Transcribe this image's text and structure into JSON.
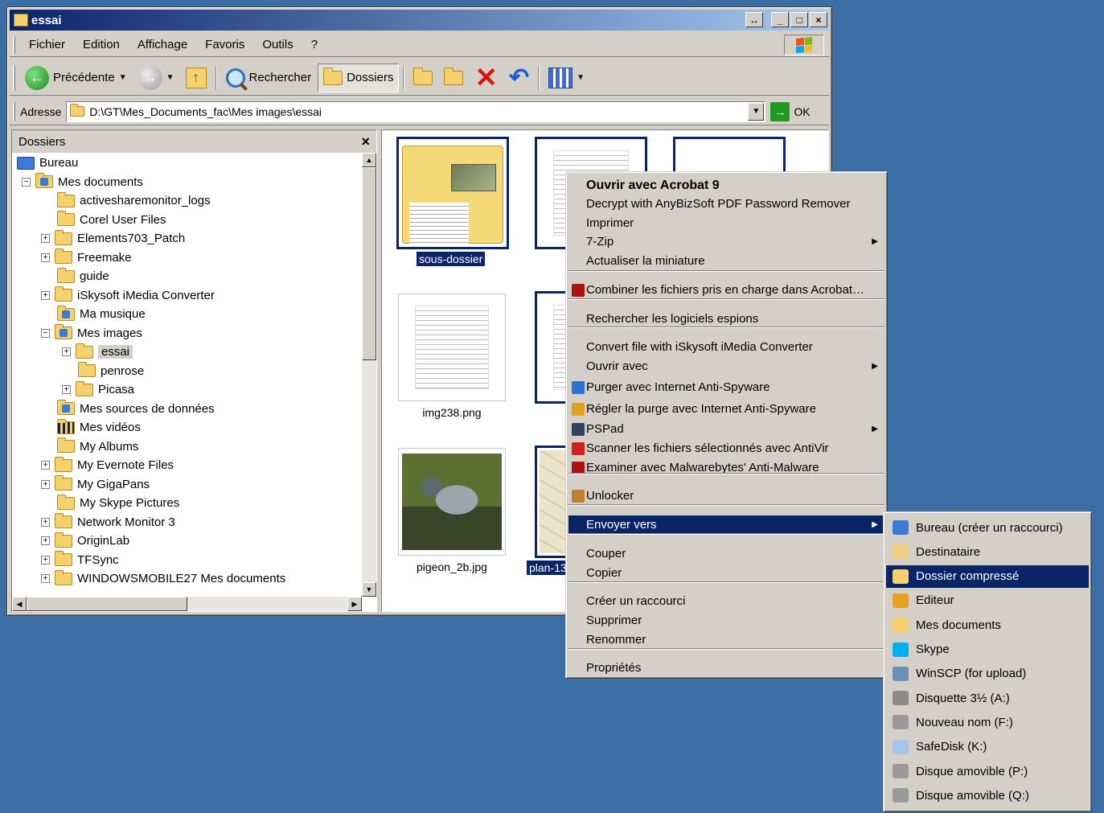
{
  "window": {
    "title": "essai",
    "buttons": {
      "restore_alt": "↔",
      "minimize": "_",
      "maximize": "□",
      "close": "×"
    }
  },
  "menubar": [
    "Fichier",
    "Edition",
    "Affichage",
    "Favoris",
    "Outils",
    "?"
  ],
  "toolbar": {
    "back_label": "Précédente",
    "search_label": "Rechercher",
    "folders_label": "Dossiers"
  },
  "address": {
    "label": "Adresse",
    "value": "D:\\GT\\Mes_Documents_fac\\Mes images\\essai",
    "go_label": "OK"
  },
  "folders_pane": {
    "title": "Dossiers",
    "close": "×",
    "items": [
      {
        "label": "Bureau",
        "icon": "desktop-icon",
        "expander": ""
      },
      {
        "label": "Mes documents",
        "icon": "my-documents-icon",
        "expander": "−"
      },
      {
        "label": "activesharemonitor_logs",
        "icon": "folder-icon",
        "expander": ""
      },
      {
        "label": "Corel User Files",
        "icon": "folder-icon",
        "expander": ""
      },
      {
        "label": "Elements703_Patch",
        "icon": "folder-icon",
        "expander": "+"
      },
      {
        "label": "Freemake",
        "icon": "folder-icon",
        "expander": "+"
      },
      {
        "label": "guide",
        "icon": "folder-icon",
        "expander": ""
      },
      {
        "label": "iSkysoft iMedia Converter",
        "icon": "folder-icon",
        "expander": "+"
      },
      {
        "label": "Ma musique",
        "icon": "music-folder-icon",
        "expander": ""
      },
      {
        "label": "Mes images",
        "icon": "pictures-folder-icon",
        "expander": "−"
      },
      {
        "label": "essai",
        "icon": "folder-icon",
        "expander": "+"
      },
      {
        "label": "penrose",
        "icon": "folder-icon",
        "expander": ""
      },
      {
        "label": "Picasa",
        "icon": "folder-icon",
        "expander": "+"
      },
      {
        "label": "Mes sources de données",
        "icon": "data-sources-folder-icon",
        "expander": ""
      },
      {
        "label": "Mes vidéos",
        "icon": "videos-folder-icon",
        "expander": ""
      },
      {
        "label": "My Albums",
        "icon": "folder-icon",
        "expander": ""
      },
      {
        "label": "My Evernote Files",
        "icon": "folder-icon",
        "expander": "+"
      },
      {
        "label": "My GigaPans",
        "icon": "folder-icon",
        "expander": "+"
      },
      {
        "label": "My Skype Pictures",
        "icon": "folder-icon",
        "expander": ""
      },
      {
        "label": "Network Monitor 3",
        "icon": "folder-icon",
        "expander": "+"
      },
      {
        "label": "OriginLab",
        "icon": "folder-icon",
        "expander": "+"
      },
      {
        "label": "TFSync",
        "icon": "folder-icon",
        "expander": "+"
      },
      {
        "label": "WINDOWSMOBILE27 Mes documents",
        "icon": "folder-icon",
        "expander": "+"
      }
    ]
  },
  "files": {
    "items": [
      {
        "name": "sous-dossier",
        "kind": "folder",
        "selected": true
      },
      {
        "name": "img238.png",
        "kind": "document",
        "selected": false
      },
      {
        "name": "pigeon_2b.jpg",
        "kind": "photo",
        "selected": false
      },
      {
        "name": "plan-13",
        "kind": "map",
        "selected": true
      }
    ]
  },
  "context_menu": {
    "groups": [
      [
        "Ouvrir avec Acrobat 9",
        "Decrypt with AnyBizSoft PDF Password Remover",
        "Imprimer",
        "7-Zip",
        "Actualiser la miniature"
      ],
      [
        "Combiner les fichiers pris en charge dans Acrobat…"
      ],
      [
        "Rechercher les logiciels espions"
      ],
      [
        "Convert file with iSkysoft iMedia Converter",
        "Ouvrir avec",
        "Purger avec Internet Anti-Spyware",
        "Régler la purge avec Internet Anti-Spyware",
        "PSPad",
        "Scanner les fichiers sélectionnés avec AntiVir",
        "Examiner avec Malwarebytes' Anti-Malware"
      ],
      [
        "Unlocker"
      ],
      [
        "Envoyer vers"
      ],
      [
        "Couper",
        "Copier"
      ],
      [
        "Créer un raccourci",
        "Supprimer",
        "Renommer"
      ],
      [
        "Propriétés"
      ]
    ],
    "highlighted": "Envoyer vers"
  },
  "send_to_menu": {
    "items": [
      {
        "label": "Bureau (créer un raccourci)",
        "icon": "desktop-shortcut-icon",
        "color": "#3b7bd6"
      },
      {
        "label": "Destinataire",
        "icon": "mail-recipient-icon",
        "color": "#f0d080"
      },
      {
        "label": "Dossier compressé",
        "icon": "zip-folder-icon",
        "color": "#f4d16c"
      },
      {
        "label": "Editeur",
        "icon": "editor-icon",
        "color": "#e8a020"
      },
      {
        "label": "Mes documents",
        "icon": "my-documents-icon",
        "color": "#f4d16c"
      },
      {
        "label": "Skype",
        "icon": "skype-icon",
        "color": "#00aff0"
      },
      {
        "label": "WinSCP (for upload)",
        "icon": "winscp-icon",
        "color": "#6a8fb8"
      },
      {
        "label": "Disquette 3½ (A:)",
        "icon": "floppy-drive-icon",
        "color": "#8a8a8a"
      },
      {
        "label": "Nouveau nom (F:)",
        "icon": "removable-drive-icon",
        "color": "#9a9a9a"
      },
      {
        "label": "SafeDisk (K:)",
        "icon": "safedisk-drive-icon",
        "color": "#a8c4e8"
      },
      {
        "label": "Disque amovible (P:)",
        "icon": "removable-drive-icon",
        "color": "#9a9a9a"
      },
      {
        "label": "Disque amovible (Q:)",
        "icon": "removable-drive-icon",
        "color": "#9a9a9a"
      }
    ],
    "highlighted": "Dossier compressé"
  }
}
